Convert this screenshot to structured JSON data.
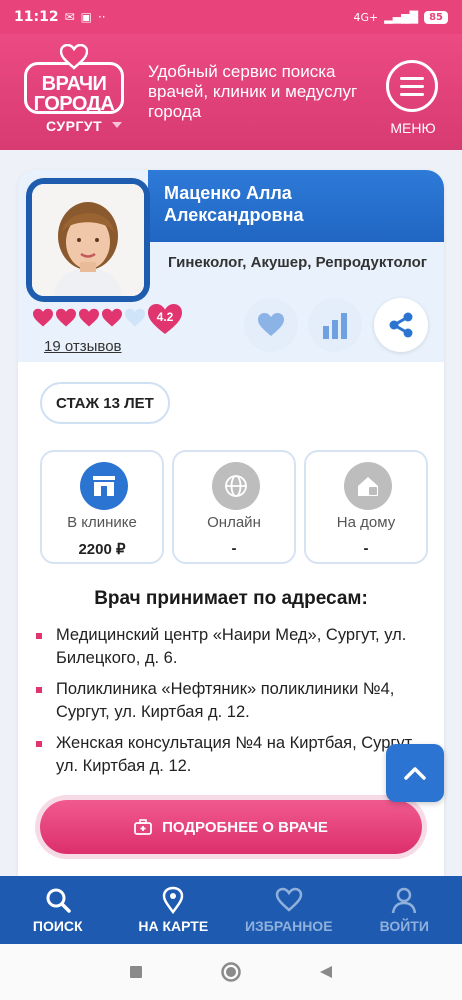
{
  "status_bar": {
    "time": "11:12",
    "network": "4G+",
    "battery": "85"
  },
  "header": {
    "logo_text_line1": "ВРАЧИ",
    "logo_text_line2": "ГОРОДА",
    "city": "СУРГУТ",
    "tagline": "Удобный сервис поиска врачей, клиник и медуслуг города",
    "menu_label": "МЕНЮ"
  },
  "doctor": {
    "name": "Маценко Алла Александровна",
    "specialty": "Гинеколог, Акушер, Репродуктолог",
    "rating": "4.2",
    "rating_hearts": 4,
    "hearts_total": 5,
    "reviews": "19 отзывов",
    "experience": "СТАЖ 13 ЛЕТ"
  },
  "prices": [
    {
      "label": "В клинике",
      "value": "2200 ₽"
    },
    {
      "label": "Онлайн",
      "value": "-"
    },
    {
      "label": "На дому",
      "value": "-"
    }
  ],
  "addresses": {
    "title": "Врач принимает по адресам:",
    "items": [
      "Медицинский центр «Наири Мед», Сургут, ул. Билецкого, д. 6.",
      "Поликлиника «Нефтяник» поликлиники №4, Сургут, ул. Киртбая д. 12.",
      "Женская консультация №4 на Киртбая, Сургут, ул. Киртбая д. 12."
    ]
  },
  "more_button": "ПОДРОБНЕЕ О ВРАЧЕ",
  "bottom_nav": [
    {
      "label": "ПОИСК"
    },
    {
      "label": "НА КАРТЕ"
    },
    {
      "label": "ИЗБРАННОЕ"
    },
    {
      "label": "ВОЙТИ"
    }
  ],
  "colors": {
    "brand_pink": "#e8437a",
    "brand_blue": "#1d5ab0",
    "accent_blue": "#2c74d2"
  }
}
